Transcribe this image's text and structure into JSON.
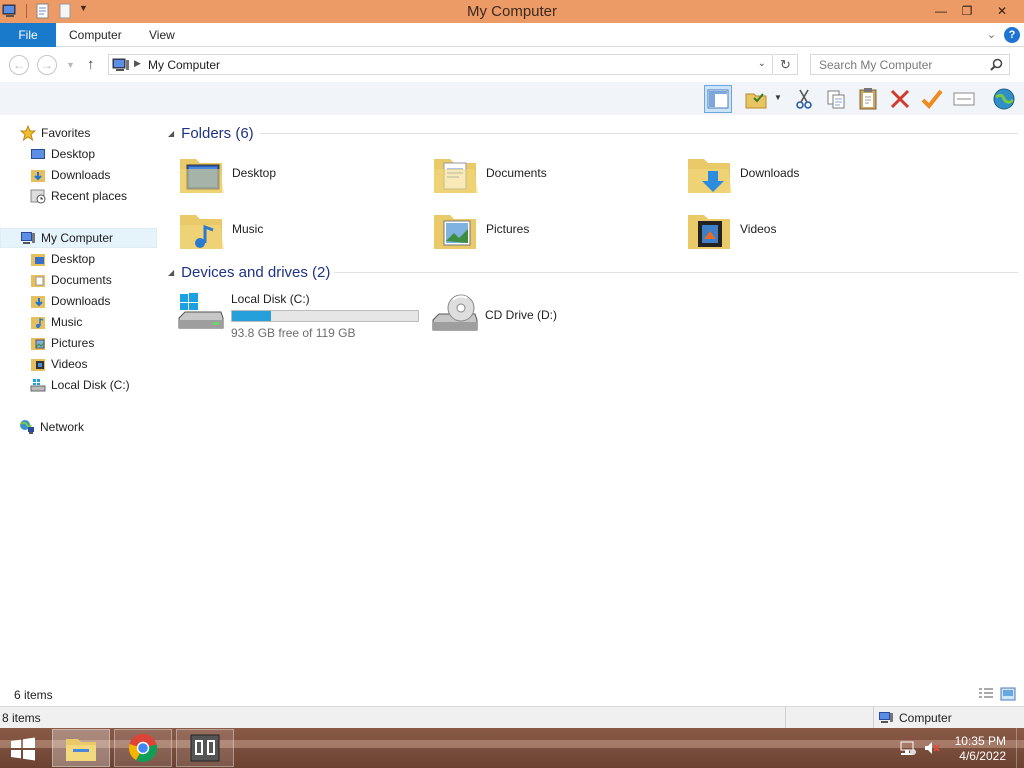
{
  "window": {
    "title": "My Computer",
    "controls": {
      "minimize": "—",
      "maximize": "❐",
      "close": "✕"
    }
  },
  "ribbon": {
    "tabs": [
      {
        "label": "File",
        "active": true
      },
      {
        "label": "Computer"
      },
      {
        "label": "View"
      }
    ],
    "help": "?"
  },
  "address_bar": {
    "crumb": "My Computer",
    "search_placeholder": "Search My Computer"
  },
  "toolbar": {
    "buttons": [
      "preview-pane",
      "new-folder",
      "cut",
      "copy",
      "paste",
      "delete",
      "properties",
      "rename",
      "network"
    ]
  },
  "nav_pane": {
    "favorites": {
      "label": "Favorites",
      "items": [
        "Desktop",
        "Downloads",
        "Recent places"
      ]
    },
    "computer": {
      "label": "My Computer",
      "items": [
        "Desktop",
        "Documents",
        "Downloads",
        "Music",
        "Pictures",
        "Videos",
        "Local Disk (C:)"
      ]
    },
    "network": {
      "label": "Network"
    }
  },
  "content": {
    "folders_header": "Folders (6)",
    "folders": [
      "Desktop",
      "Documents",
      "Downloads",
      "Music",
      "Pictures",
      "Videos"
    ],
    "devices_header": "Devices and drives (2)",
    "drives": [
      {
        "name": "Local Disk (C:)",
        "free_text": "93.8 GB free of 119 GB",
        "used_fraction": 0.21
      },
      {
        "name": "CD Drive (D:)"
      }
    ]
  },
  "status": {
    "item_count": "6 items",
    "outer_count": "8 items",
    "zone": "Computer"
  },
  "taskbar": {
    "time": "10:35 PM",
    "date": "4/6/2022"
  },
  "colors": {
    "titlebar": "#ec9a66",
    "file_tab": "#1979ca",
    "group_header": "#1e3287",
    "progress": "#26a0da"
  }
}
